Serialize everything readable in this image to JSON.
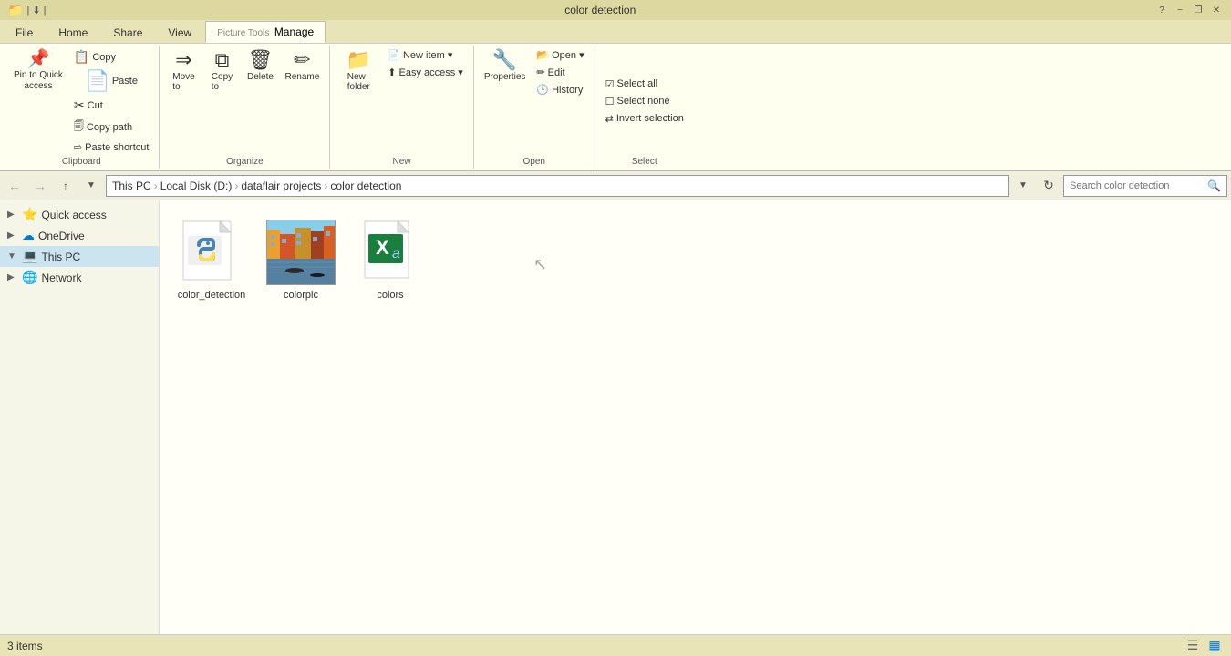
{
  "titlebar": {
    "title": "color detection",
    "ribbon_tab": "Picture Tools",
    "min_label": "−",
    "max_label": "□",
    "close_label": "✕",
    "restore_label": "❐",
    "help_label": "?"
  },
  "tabs": [
    {
      "id": "file",
      "label": "File"
    },
    {
      "id": "home",
      "label": "Home",
      "active": true
    },
    {
      "id": "share",
      "label": "Share"
    },
    {
      "id": "view",
      "label": "View"
    },
    {
      "id": "manage",
      "label": "Manage"
    }
  ],
  "ribbon": {
    "groups": [
      {
        "id": "clipboard",
        "label": "Clipboard",
        "buttons": [
          {
            "id": "pin",
            "icon": "📌",
            "label": "Pin to Quick\naccess",
            "large": true
          },
          {
            "id": "copy",
            "icon": "📋",
            "label": "Copy",
            "large": false
          },
          {
            "id": "paste",
            "icon": "📄",
            "label": "Paste",
            "large": true
          }
        ],
        "small_buttons": [
          {
            "id": "cut",
            "icon": "✂",
            "label": "Cut"
          },
          {
            "id": "copy-path",
            "icon": "🗐",
            "label": "Copy path"
          },
          {
            "id": "paste-shortcut",
            "icon": "⇨",
            "label": "Paste shortcut"
          }
        ]
      },
      {
        "id": "organize",
        "label": "Organize",
        "buttons": [
          {
            "id": "move-to",
            "icon": "⇒",
            "label": "Move\nto"
          },
          {
            "id": "copy-to",
            "icon": "⧉",
            "label": "Copy\nto"
          },
          {
            "id": "delete",
            "icon": "🗑",
            "label": "Delete"
          },
          {
            "id": "rename",
            "icon": "✏",
            "label": "Rename"
          }
        ]
      },
      {
        "id": "new",
        "label": "New",
        "buttons": [
          {
            "id": "new-folder",
            "icon": "📁",
            "label": "New\nfolder"
          },
          {
            "id": "new-item",
            "icon": "📄",
            "label": "New item ▾"
          }
        ],
        "small_buttons": [
          {
            "id": "easy-access",
            "icon": "⬆",
            "label": "Easy access ▾"
          }
        ]
      },
      {
        "id": "open",
        "label": "Open",
        "buttons": [
          {
            "id": "properties",
            "icon": "🔧",
            "label": "Properties"
          },
          {
            "id": "open",
            "icon": "📂",
            "label": "Open ▾"
          }
        ],
        "small_buttons": [
          {
            "id": "edit",
            "icon": "✏",
            "label": "Edit"
          },
          {
            "id": "history",
            "icon": "🕒",
            "label": "History"
          }
        ]
      },
      {
        "id": "select",
        "label": "Select",
        "buttons": [
          {
            "id": "select-all",
            "icon": "☑",
            "label": "Select all"
          },
          {
            "id": "select-none",
            "icon": "☐",
            "label": "Select none"
          },
          {
            "id": "invert-selection",
            "icon": "⇄",
            "label": "Invert selection"
          }
        ]
      }
    ]
  },
  "navbar": {
    "back_label": "←",
    "forward_label": "→",
    "up_label": "↑",
    "breadcrumb": [
      {
        "label": "This PC"
      },
      {
        "label": "Local Disk (D:)"
      },
      {
        "label": "dataflair projects"
      },
      {
        "label": "color detection"
      }
    ],
    "search_placeholder": "Search color detection"
  },
  "sidebar": {
    "items": [
      {
        "id": "quick-access",
        "icon": "⭐",
        "label": "Quick access",
        "expanded": false,
        "indent": 0
      },
      {
        "id": "onedrive",
        "icon": "☁",
        "label": "OneDrive",
        "expanded": false,
        "indent": 0
      },
      {
        "id": "this-pc",
        "icon": "💻",
        "label": "This PC",
        "expanded": true,
        "selected": true,
        "indent": 0
      },
      {
        "id": "network",
        "icon": "🌐",
        "label": "Network",
        "expanded": false,
        "indent": 0
      }
    ]
  },
  "files": [
    {
      "id": "color-detection",
      "name": "color_detection",
      "type": "python"
    },
    {
      "id": "colorpic",
      "name": "colorpic",
      "type": "image"
    },
    {
      "id": "colors",
      "name": "colors",
      "type": "excel"
    }
  ],
  "statusbar": {
    "items_count": "3 items",
    "view_icons": [
      "list",
      "details"
    ]
  }
}
